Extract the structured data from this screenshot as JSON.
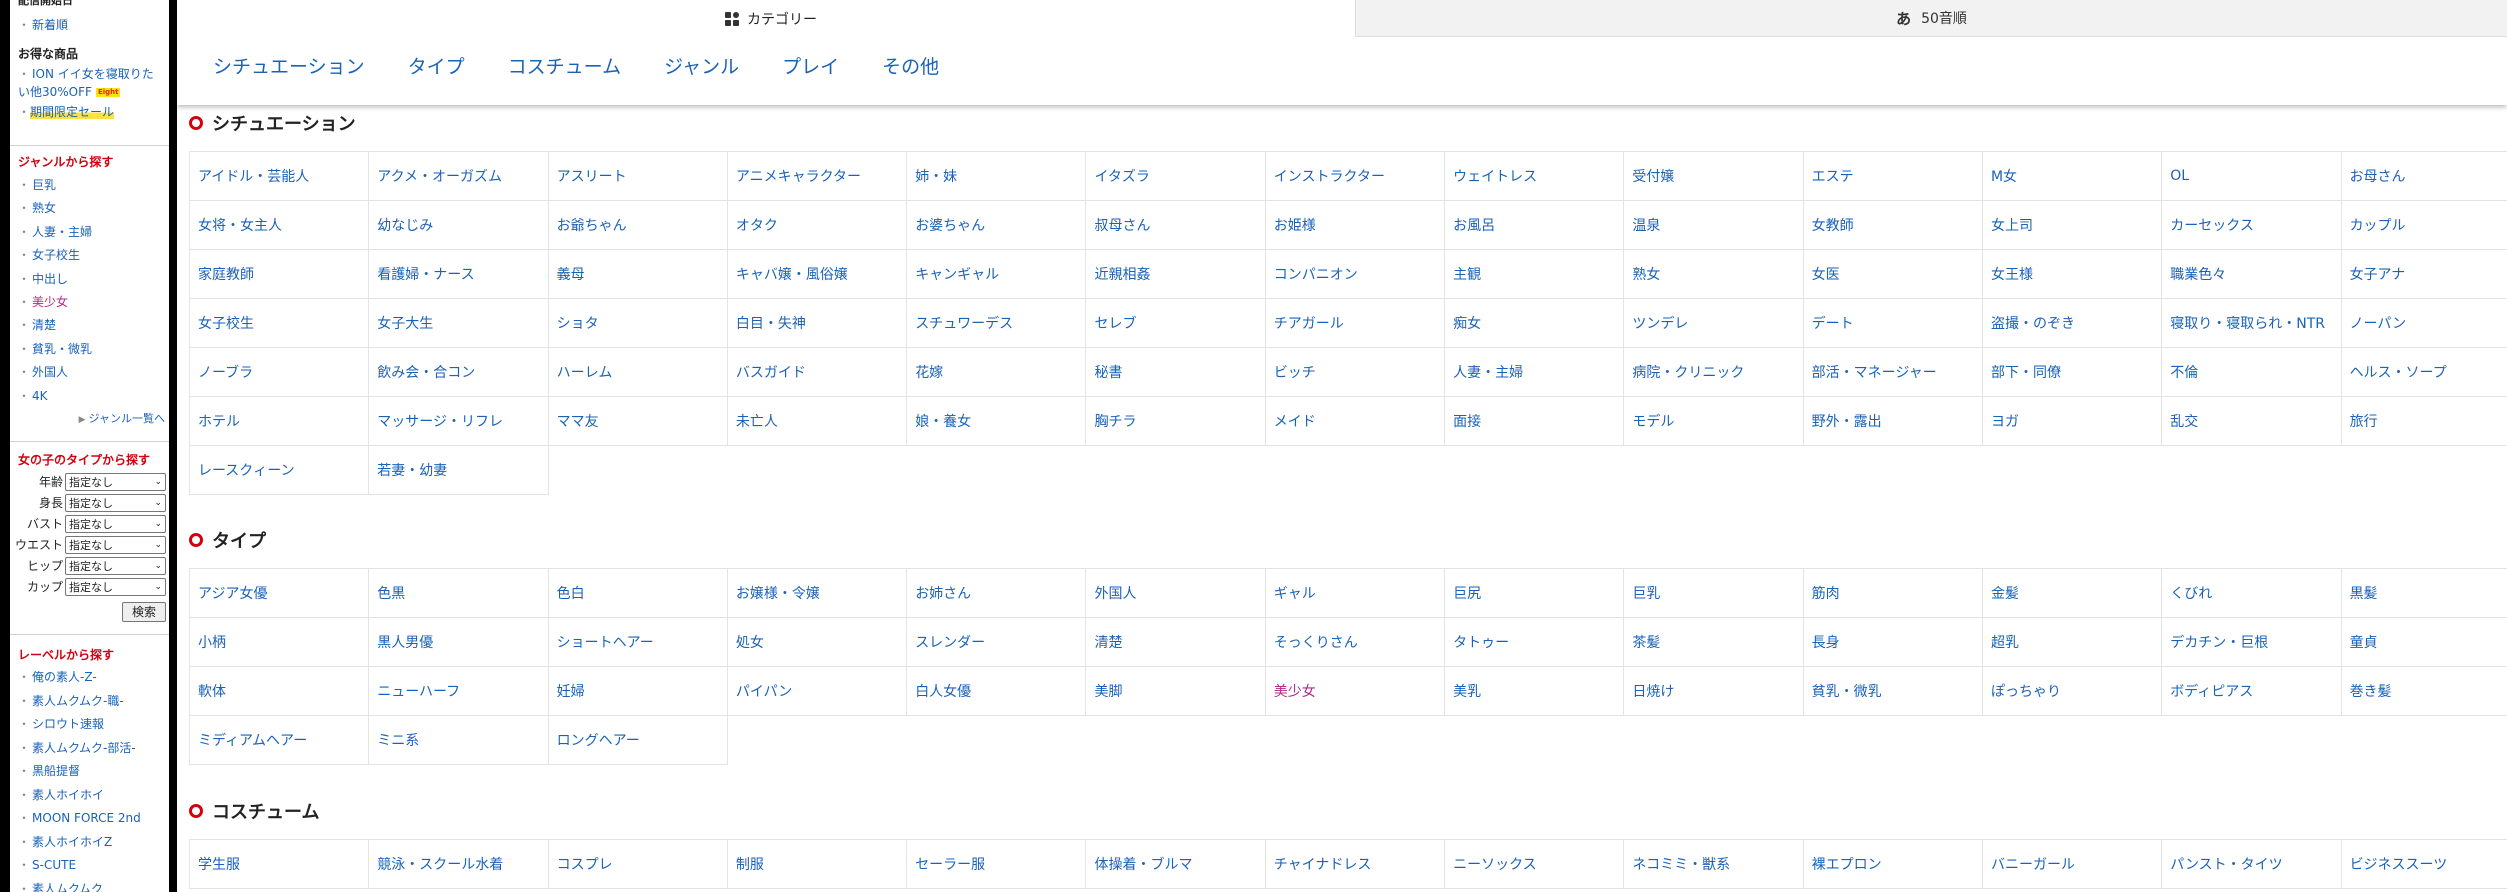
{
  "sidebar": {
    "cut_heading": "配信開始日",
    "top_link": "新着順",
    "deals_heading": "お得な商品",
    "deals": [
      {
        "label": "ION イイ女を寝取りたい他30%OFF",
        "badge": "Eight"
      },
      {
        "label": "期間限定セール"
      }
    ],
    "genre_heading": "ジャンルから探す",
    "genres": [
      "巨乳",
      "熟女",
      "人妻・主婦",
      "女子校生",
      "中出し",
      "美少女",
      "清楚",
      "貧乳・微乳",
      "外国人",
      "4K"
    ],
    "genre_more": "ジャンル一覧へ",
    "type_heading": "女の子のタイプから探す",
    "type_filters": [
      {
        "label": "年齢",
        "value": "指定なし"
      },
      {
        "label": "身長",
        "value": "指定なし"
      },
      {
        "label": "バスト",
        "value": "指定なし"
      },
      {
        "label": "ウエスト",
        "value": "指定なし"
      },
      {
        "label": "ヒップ",
        "value": "指定なし"
      },
      {
        "label": "カップ",
        "value": "指定なし"
      }
    ],
    "search_button": "検索",
    "label_heading": "レーベルから探す",
    "labels": [
      "俺の素人-Z-",
      "素人ムクムク-職-",
      "シロウト速報",
      "素人ムクムク-部活-",
      "黒船提督",
      "素人ホイホイ",
      "MOON FORCE 2nd",
      "素人ホイホイZ",
      "S-CUTE",
      "素人ムクムク"
    ]
  },
  "tabs": {
    "category": "カテゴリー",
    "kana": "50音順",
    "kana_icon": "あ"
  },
  "catnav": [
    "シチュエーション",
    "タイプ",
    "コスチューム",
    "ジャンル",
    "プレイ",
    "その他"
  ],
  "sections": [
    {
      "title": "シチュエーション",
      "rows": [
        [
          "アイドル・芸能人",
          "アクメ・オーガズム",
          "アスリート",
          "アニメキャラクター",
          "姉・妹",
          "イタズラ",
          "インストラクター",
          "ウェイトレス",
          "受付嬢",
          "エステ",
          "M女",
          "OL",
          "お母さん"
        ],
        [
          "女将・女主人",
          "幼なじみ",
          "お爺ちゃん",
          "オタク",
          "お婆ちゃん",
          "叔母さん",
          "お姫様",
          "お風呂",
          "温泉",
          "女教師",
          "女上司",
          "カーセックス",
          "カップル"
        ],
        [
          "家庭教師",
          "看護婦・ナース",
          "義母",
          "キャバ嬢・風俗嬢",
          "キャンギャル",
          "近親相姦",
          "コンパニオン",
          "主観",
          "熟女",
          "女医",
          "女王様",
          "職業色々",
          "女子アナ"
        ],
        [
          "女子校生",
          "女子大生",
          "ショタ",
          "白目・失神",
          "スチュワーデス",
          "セレブ",
          "チアガール",
          "痴女",
          "ツンデレ",
          "デート",
          "盗撮・のぞき",
          "寝取り・寝取られ・NTR",
          "ノーパン"
        ],
        [
          "ノーブラ",
          "飲み会・合コン",
          "ハーレム",
          "バスガイド",
          "花嫁",
          "秘書",
          "ビッチ",
          "人妻・主婦",
          "病院・クリニック",
          "部活・マネージャー",
          "部下・同僚",
          "不倫",
          "ヘルス・ソープ"
        ],
        [
          "ホテル",
          "マッサージ・リフレ",
          "ママ友",
          "未亡人",
          "娘・養女",
          "胸チラ",
          "メイド",
          "面接",
          "モデル",
          "野外・露出",
          "ヨガ",
          "乱交",
          "旅行"
        ],
        [
          "レースクィーン",
          "若妻・幼妻"
        ]
      ]
    },
    {
      "title": "タイプ",
      "rows": [
        [
          "アジア女優",
          "色黒",
          "色白",
          "お嬢様・令嬢",
          "お姉さん",
          "外国人",
          "ギャル",
          "巨尻",
          "巨乳",
          "筋肉",
          "金髪",
          "くびれ",
          "黒髪"
        ],
        [
          "小柄",
          "黒人男優",
          "ショートヘアー",
          "処女",
          "スレンダー",
          "清楚",
          "そっくりさん",
          "タトゥー",
          "茶髪",
          "長身",
          "超乳",
          "デカチン・巨根",
          "童貞"
        ],
        [
          "軟体",
          "ニューハーフ",
          "妊婦",
          "パイパン",
          "白人女優",
          "美脚",
          "美少女",
          "美乳",
          "日焼け",
          "貧乳・微乳",
          "ぽっちゃり",
          "ボディピアス",
          "巻き髪"
        ],
        [
          "ミディアムヘアー",
          "ミニ系",
          "ロングヘアー"
        ]
      ]
    },
    {
      "title": "コスチューム",
      "rows": [
        [
          "学生服",
          "競泳・スクール水着",
          "コスプレ",
          "制服",
          "セーラー服",
          "体操着・ブルマ",
          "チャイナドレス",
          "ニーソックス",
          "ネコミミ・獣系",
          "裸エプロン",
          "バニーガール",
          "パンスト・タイツ",
          "ビジネススーツ"
        ]
      ]
    }
  ],
  "colors": {
    "link": "#1a62b8",
    "visited": "#b0288c",
    "accent_red": "#d4000e"
  }
}
